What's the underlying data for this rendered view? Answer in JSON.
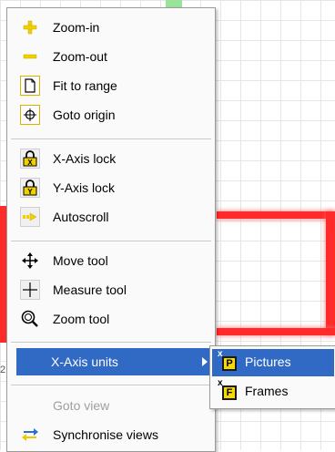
{
  "menu": {
    "items": [
      {
        "label": "Zoom-in",
        "icon": "zoom-in-plus-icon"
      },
      {
        "label": "Zoom-out",
        "icon": "zoom-out-minus-icon"
      },
      {
        "label": "Fit to range",
        "icon": "fit-to-range-icon"
      },
      {
        "label": "Goto origin",
        "icon": "goto-origin-icon"
      },
      {
        "label": "X-Axis lock",
        "icon": "x-axis-lock-icon",
        "checked": true
      },
      {
        "label": "Y-Axis lock",
        "icon": "y-axis-lock-icon",
        "checked": true
      },
      {
        "label": "Autoscroll",
        "icon": "autoscroll-arrow-icon",
        "checked": true
      },
      {
        "label": "Move tool",
        "icon": "move-tool-icon"
      },
      {
        "label": "Measure tool",
        "icon": "measure-tool-icon",
        "checked": true
      },
      {
        "label": "Zoom tool",
        "icon": "zoom-tool-icon"
      },
      {
        "label": "X-Axis units",
        "icon": "submenu-arrow-icon",
        "highlighted": true
      },
      {
        "label": "Goto view",
        "disabled": true
      },
      {
        "label": "Synchronise views",
        "icon": "synchronise-views-icon"
      }
    ]
  },
  "submenu": {
    "items": [
      {
        "label": "Pictures",
        "badge": "P",
        "selected_mark": "x",
        "highlighted": true
      },
      {
        "label": "Frames",
        "badge": "F",
        "selected_mark": "x"
      }
    ]
  },
  "background": {
    "axis_stub": "2"
  },
  "colors": {
    "highlight": "#316ac5",
    "plot_line": "#ff2a2a",
    "icon_yellow": "#f5d900"
  }
}
